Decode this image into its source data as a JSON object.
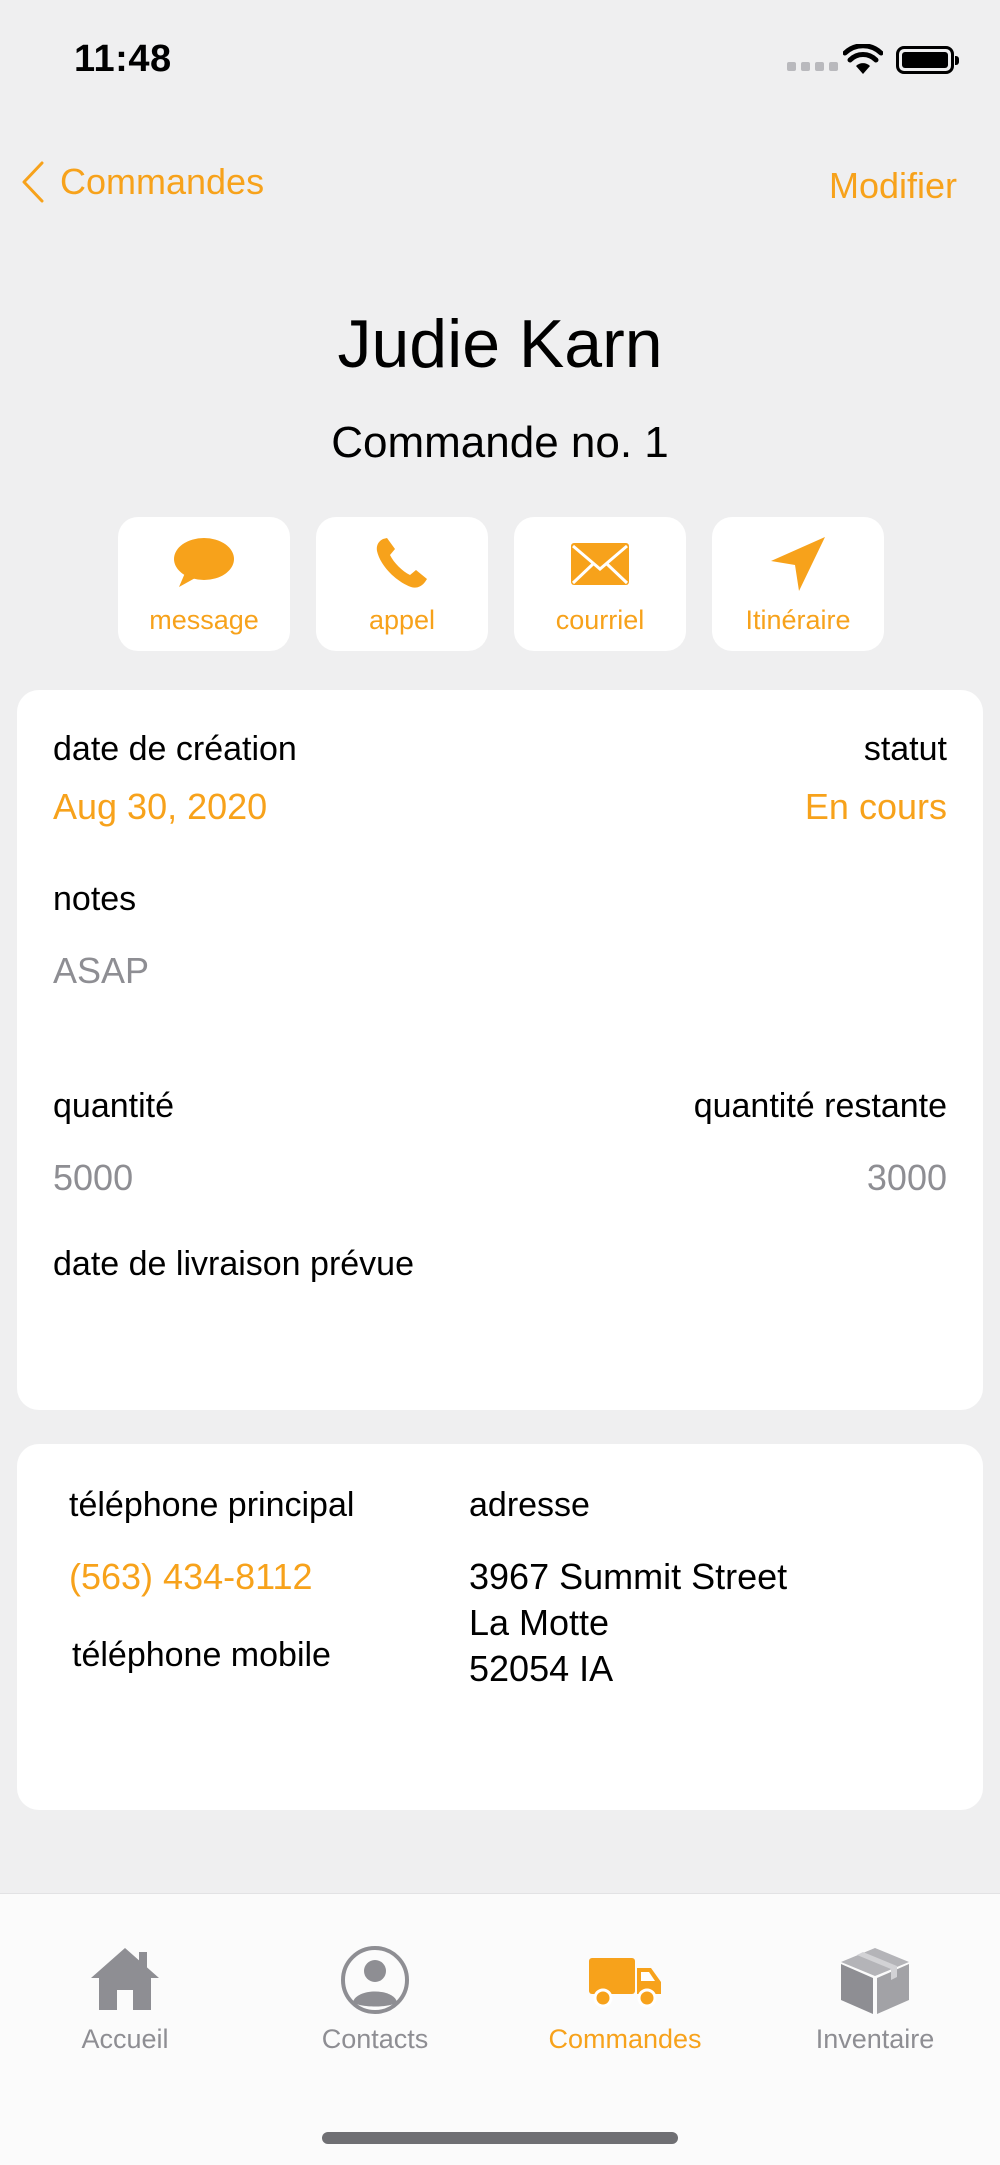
{
  "status_bar": {
    "time": "11:48"
  },
  "nav": {
    "back_label": "Commandes",
    "edit_label": "Modifier"
  },
  "header": {
    "name": "Judie Karn",
    "order": "Commande no. 1"
  },
  "actions": [
    {
      "label": "message",
      "icon": "message-bubble-icon"
    },
    {
      "label": "appel",
      "icon": "phone-icon"
    },
    {
      "label": "courriel",
      "icon": "envelope-icon"
    },
    {
      "label": "Itinéraire",
      "icon": "location-arrow-icon"
    }
  ],
  "order_card": {
    "creation_label": "date de création",
    "creation_value": "Aug 30, 2020",
    "status_label": "statut",
    "status_value": "En cours",
    "notes_label": "notes",
    "notes_value": "ASAP",
    "quantity_label": "quantité",
    "quantity_value": "5000",
    "remaining_label": "quantité restante",
    "remaining_value": "3000",
    "delivery_label": "date de livraison prévue"
  },
  "contact_card": {
    "main_phone_label": "téléphone principal",
    "main_phone_value": "(563) 434-8112",
    "mobile_phone_label": "téléphone mobile",
    "address_label": "adresse",
    "address_line1": "3967 Summit Street",
    "address_line2": "La Motte",
    "address_line3": "52054 IA"
  },
  "tabs": [
    {
      "label": "Accueil",
      "icon": "house-icon",
      "active": false
    },
    {
      "label": "Contacts",
      "icon": "person-circle-icon",
      "active": false
    },
    {
      "label": "Commandes",
      "icon": "truck-icon",
      "active": true
    },
    {
      "label": "Inventaire",
      "icon": "box-icon",
      "active": false
    }
  ],
  "colors": {
    "accent": "#f7a21b",
    "background": "#efeff0",
    "secondary_text": "#8e8e93"
  }
}
